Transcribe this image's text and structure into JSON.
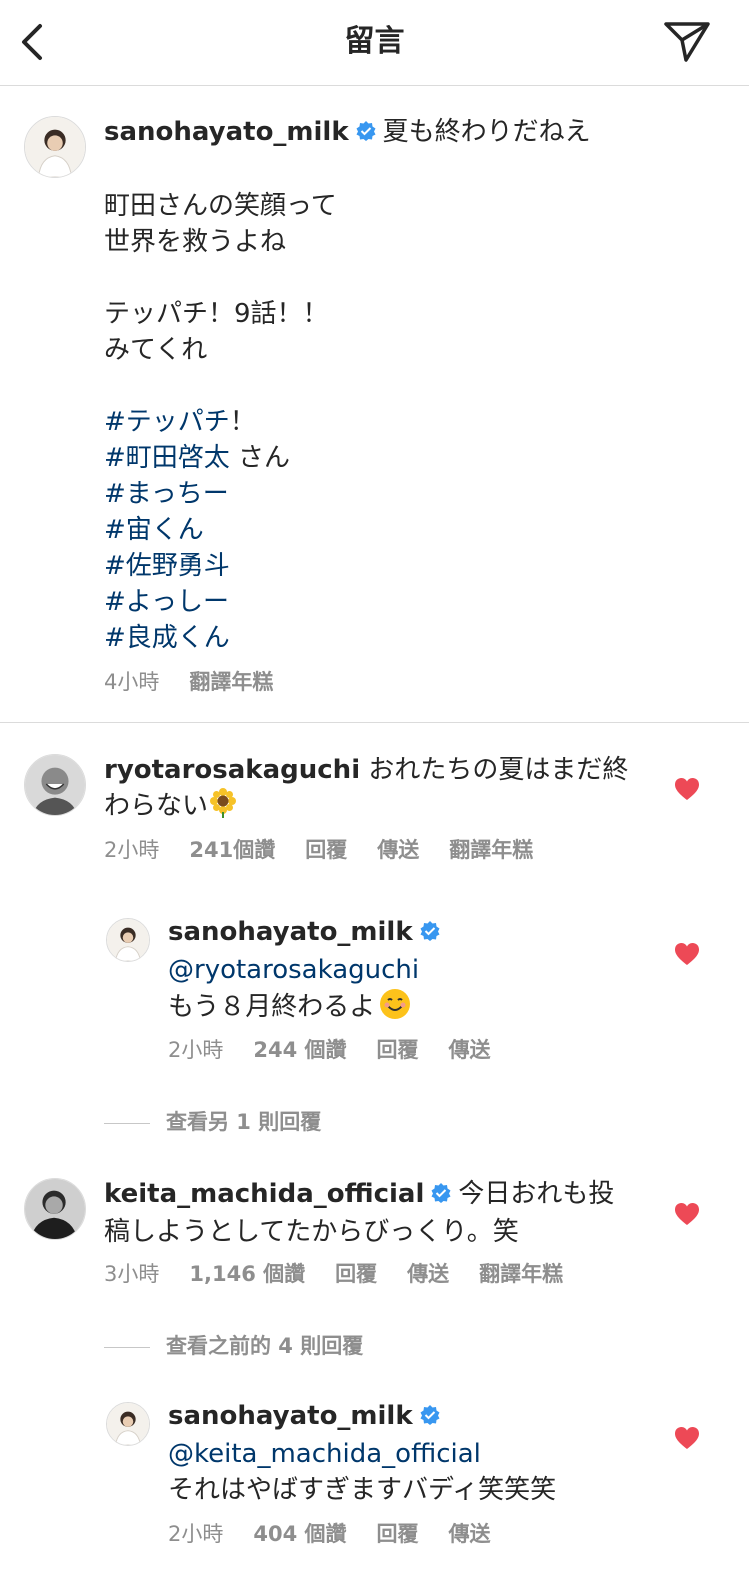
{
  "header": {
    "title": "留言"
  },
  "post": {
    "username": "sanohayato_milk",
    "caption_first": "夏も終わりだねえ",
    "lines": [
      "町田さんの笑顔って",
      "世界を救うよね",
      "テッパチ！9話！！",
      "みてくれ"
    ],
    "hashtags": [
      "#テッパチ",
      "#町田啓太",
      "#まっちー",
      "#宙くん",
      "#佐野勇斗",
      "#よっしー",
      "#良成くん"
    ],
    "hashtag1_suffix": "！",
    "hashtag2_suffix": " さん",
    "time": "4小時",
    "translate": "翻譯年糕"
  },
  "comments": [
    {
      "username": "ryotarosakaguchi",
      "text_line1": "おれたちの夏はまだ終",
      "text_line2": "わらない",
      "emoji": "sunflower",
      "time": "2小時",
      "likes": "241個讚",
      "reply": "回覆",
      "send": "傳送",
      "translate": "翻譯年糕",
      "liked": true
    },
    {
      "username": "sanohayato_milk",
      "mention": "@ryotarosakaguchi",
      "text": "もう８月終わるよ",
      "emoji": "smiling-face",
      "time": "2小時",
      "likes": "244 個讚",
      "reply": "回覆",
      "send": "傳送",
      "liked": true
    },
    {
      "username": "keita_machida_official",
      "text_line1": "今日おれも投",
      "text_line2": "稿しようとしてたからびっくり。笑",
      "time": "3小時",
      "likes": "1,146 個讚",
      "reply": "回覆",
      "send": "傳送",
      "translate": "翻譯年糕",
      "liked": true
    },
    {
      "username": "sanohayato_milk",
      "mention": "@keita_machida_official",
      "text": "それはやばすぎますバディ笑笑笑",
      "time": "2小時",
      "likes": "404 個讚",
      "reply": "回覆",
      "send": "傳送",
      "liked": true
    }
  ],
  "view_more_1": "查看另 1 則回覆",
  "view_more_2": "查看之前的 4 則回覆",
  "colors": {
    "link": "#00376b",
    "heart": "#ed4956",
    "verified": "#3897f0",
    "meta": "#8e8e8e"
  }
}
